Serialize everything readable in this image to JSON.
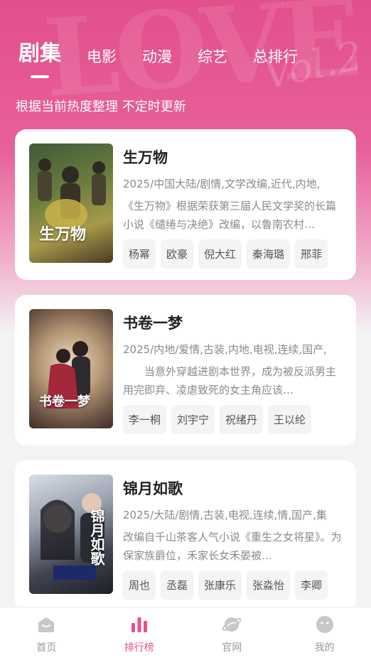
{
  "tabs": [
    {
      "label": "剧集",
      "active": true
    },
    {
      "label": "电影"
    },
    {
      "label": "动漫"
    },
    {
      "label": "综艺"
    },
    {
      "label": "总排行"
    }
  ],
  "subtitle": "根据当前热度整理 不定时更新",
  "shows": [
    {
      "title": "生万物",
      "poster_text": "生万物",
      "meta": "2025/中国大陆/剧情,文学改编,近代,内地,",
      "desc": "《生万物》根据荣获第三届人民文学奖的长篇小说《缱绻与决绝》改编，以鲁南农村…",
      "cast": [
        "杨幂",
        "欧豪",
        "倪大红",
        "秦海璐",
        "邢菲"
      ]
    },
    {
      "title": "书卷一梦",
      "poster_text": "书卷一梦",
      "meta": "2025/内地/爱情,古装,内地,电视,连续,国产,",
      "desc": "　　当意外穿越进剧本世界，成为被反派男主用完即弃、凌虐致死的女主角应该…",
      "cast": [
        "李一桐",
        "刘宇宁",
        "祝绪丹",
        "王以纶"
      ]
    },
    {
      "title": "锦月如歌",
      "poster_text": "锦月如歌",
      "meta": "2025/大陆/剧情,古装,电视,连续,情,国产,集",
      "desc": "改编自千山茶客人气小说《重生之女将星》。为保家族爵位，禾家长女禾晏被…",
      "cast": [
        "周也",
        "丞磊",
        "张康乐",
        "张淼怡",
        "李卿"
      ]
    }
  ],
  "nav": [
    {
      "label": "首页",
      "icon": "home-icon"
    },
    {
      "label": "排行榜",
      "icon": "ranking-icon",
      "active": true
    },
    {
      "label": "官网",
      "icon": "planet-icon"
    },
    {
      "label": "我的",
      "icon": "profile-icon"
    }
  ],
  "colors": {
    "accent": "#e8508f",
    "hero": "#e24f8c"
  }
}
